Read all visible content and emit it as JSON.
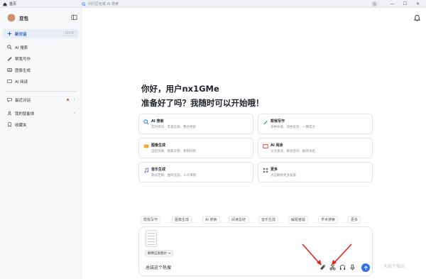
{
  "titlebar": {
    "tab_label": "首页",
    "search_placeholder": "问问豆包或 AI 搜索",
    "avatar_text": "豆",
    "minimize": "—",
    "restore": "☐",
    "close": "✕"
  },
  "sidebar": {
    "brand": "豆包",
    "new_chat_label": "新对话",
    "new_chat_shortcut": "Ctrl K",
    "items": [
      {
        "label": "AI 搜索",
        "icon": "search-icon"
      },
      {
        "label": "帮我写作",
        "icon": "pen-icon"
      },
      {
        "label": "图像生成",
        "icon": "image-icon"
      },
      {
        "label": "AI 阅读",
        "icon": "book-icon"
      }
    ],
    "recent_label": "最近对话",
    "agents_label": "我的智能体",
    "favorites_label": "收藏夹"
  },
  "main": {
    "greeting_line1": "你好，用户nx1GMe",
    "greeting_line2": "准备好了吗？我随时可以开始哦！"
  },
  "cards": [
    {
      "title": "AI 搜索",
      "subtitle": "实时资讯、丰富信源、整合搜索",
      "icon": "search-icon",
      "color": "#3b82f6"
    },
    {
      "title": "帮我写作",
      "subtitle": "多种体裁、润色校对、一键成文",
      "icon": "pen-icon",
      "color": "#22a06b"
    },
    {
      "title": "图像生成",
      "subtitle": "自定风格、搜集灵感、复制同款",
      "icon": "image-icon",
      "color": "#f59e0b"
    },
    {
      "title": "AI 阅读",
      "subtitle": "论文速读、解读合同、翻译总结",
      "icon": "book-icon",
      "color": "#ef4444"
    },
    {
      "title": "音乐生成",
      "subtitle": "歌词定制、曲风任选、人声演唱",
      "icon": "music-icon",
      "color": "#6366f1"
    },
    {
      "title": "更多",
      "subtitle": "点击解锁更多技能",
      "icon": "grid-icon",
      "color": "#6b7280"
    }
  ],
  "chips": [
    "帮我写作",
    "图像生成",
    "AI 搜索",
    "阅读总结",
    "音乐生成",
    "解题答疑",
    "学术搜索",
    "更多"
  ],
  "input": {
    "attachment_label": "解释这张图片 →",
    "text": "总结这个热搜"
  },
  "watermark": "天极下载站",
  "colors": {
    "accent": "#2f6fed",
    "arrow": "#e5231b"
  }
}
